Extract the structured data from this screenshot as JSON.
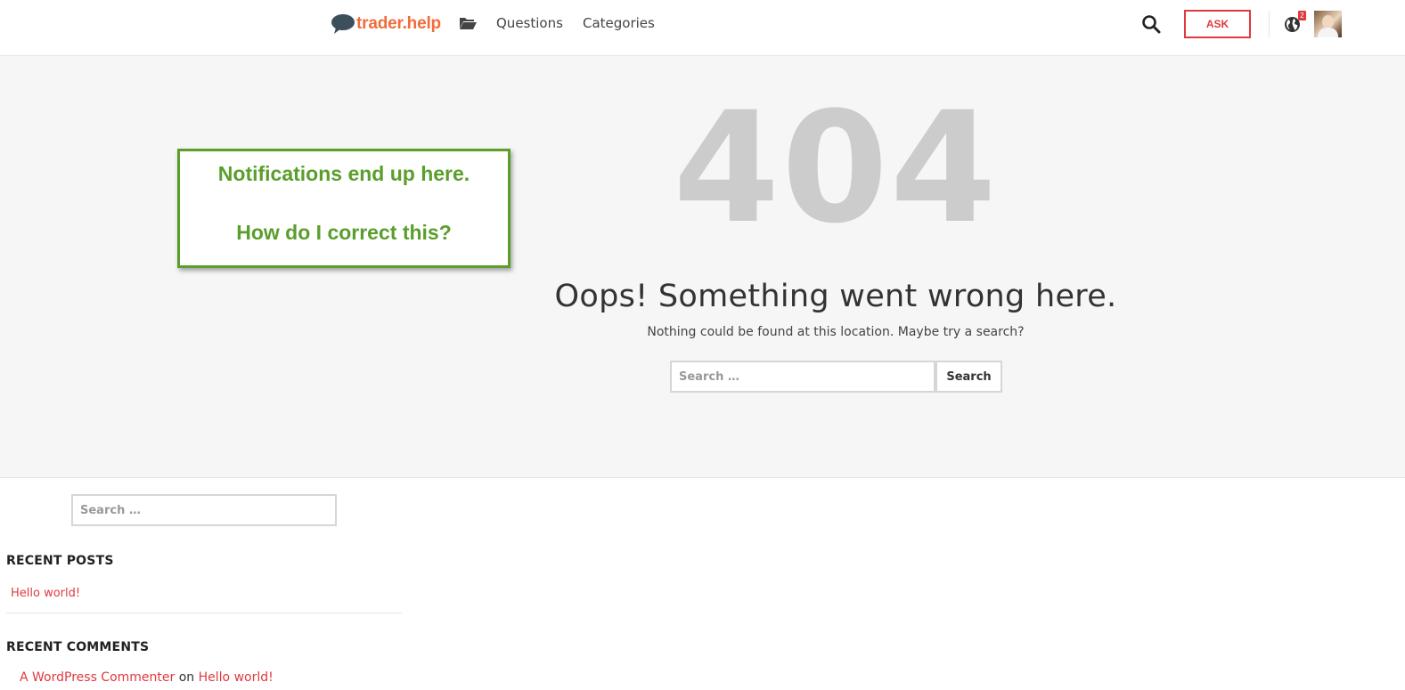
{
  "header": {
    "logo_text": "trader.help",
    "nav": {
      "questions": "Questions",
      "categories": "Categories"
    },
    "ask_label": "ASK",
    "notification_count": "2",
    "icons": [
      "logo-bubble-icon",
      "folder-icon",
      "search-icon",
      "globe-icon"
    ]
  },
  "hero": {
    "code": "404",
    "title": "Oops! Something went wrong here.",
    "subtitle": "Nothing could be found at this location. Maybe try a search?",
    "search": {
      "placeholder": "Search …",
      "button": "Search"
    }
  },
  "annotation": {
    "line1": "Notifications end up here.",
    "line2": "How do I correct this?"
  },
  "sidebar": {
    "search_placeholder": "Search …",
    "recent_posts": {
      "title": "RECENT POSTS",
      "items": [
        {
          "label": "Hello world!"
        }
      ]
    },
    "recent_comments": {
      "title": "RECENT COMMENTS",
      "items": [
        {
          "author": "A WordPress Commenter",
          "joiner": "on",
          "post": "Hello world!"
        }
      ]
    }
  },
  "colors": {
    "accent": "#e0393e",
    "logo": "#f26b3a",
    "annotation": "#5a9e2c",
    "hero_bg": "#f6f6f6",
    "big_code": "#cccccc"
  }
}
